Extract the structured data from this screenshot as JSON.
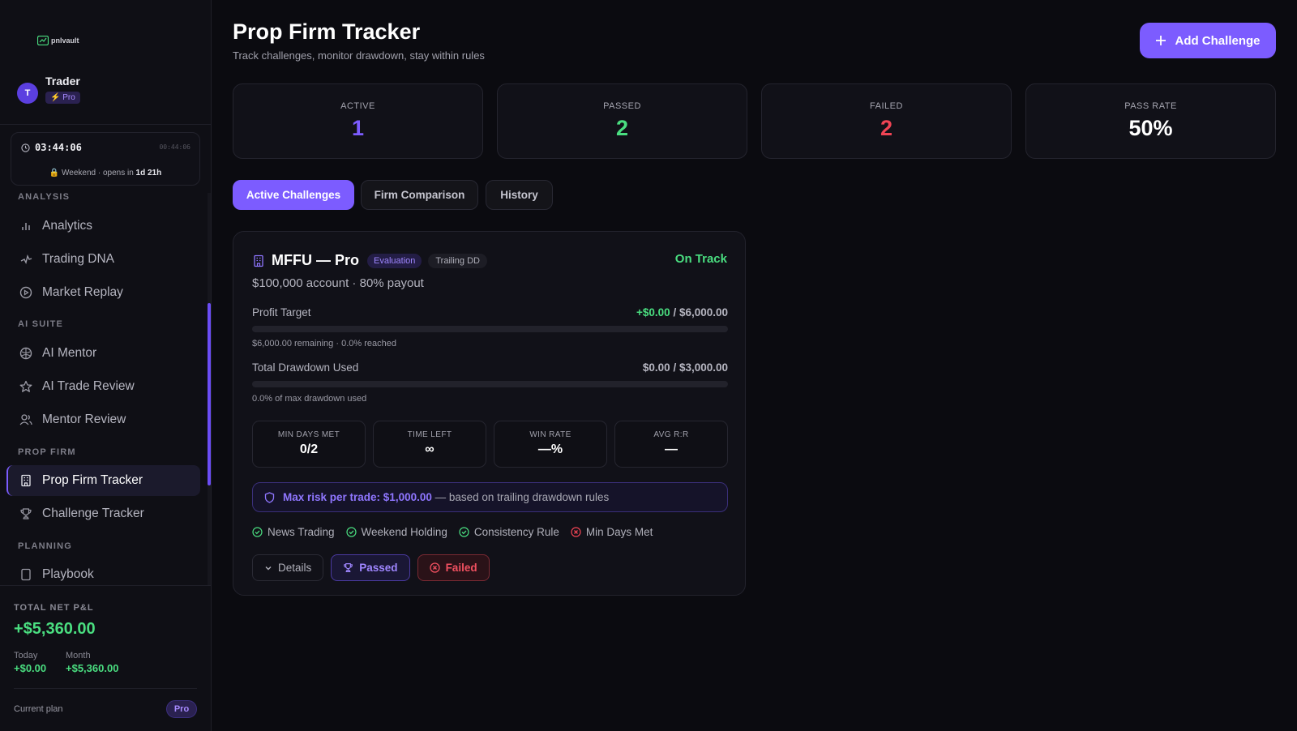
{
  "app": {
    "logo_text": "pnlvault",
    "user_name": "Trader",
    "user_initial": "T",
    "plan_chip": "⚡ Pro"
  },
  "session": {
    "time": "03:44:06",
    "time_small": "00:44:06",
    "status_prefix": "🔒 Weekend · opens in ",
    "status_time": "1d 21h"
  },
  "sidebar": {
    "sections": [
      {
        "label": "ANALYSIS",
        "items": [
          {
            "label": "Analytics",
            "icon": "bar-chart-icon"
          },
          {
            "label": "Trading DNA",
            "icon": "dna-icon"
          },
          {
            "label": "Market Replay",
            "icon": "play-circle-icon"
          }
        ]
      },
      {
        "label": "AI SUITE",
        "items": [
          {
            "label": "AI Mentor",
            "icon": "brain-icon"
          },
          {
            "label": "AI Trade Review",
            "icon": "star-icon"
          },
          {
            "label": "Mentor Review",
            "icon": "users-icon"
          }
        ]
      },
      {
        "label": "PROP FIRM",
        "items": [
          {
            "label": "Prop Firm Tracker",
            "icon": "building-icon",
            "active": true
          },
          {
            "label": "Challenge Tracker",
            "icon": "trophy-icon"
          }
        ]
      },
      {
        "label": "PLANNING",
        "items": [
          {
            "label": "Playbook",
            "icon": "book-icon"
          }
        ]
      }
    ]
  },
  "pnl": {
    "label": "TOTAL NET P&L",
    "value": "+$5,360.00",
    "today_label": "Today",
    "today_value": "+$0.00",
    "month_label": "Month",
    "month_value": "+$5,360.00",
    "plan_label": "Current plan",
    "plan_value": "Pro"
  },
  "header": {
    "title": "Prop Firm Tracker",
    "subtitle": "Track challenges, monitor drawdown, stay within rules",
    "add_button": "Add Challenge"
  },
  "stats": [
    {
      "label": "ACTIVE",
      "value": "1",
      "color": "#7c5cff"
    },
    {
      "label": "PASSED",
      "value": "2",
      "color": "#4ade80"
    },
    {
      "label": "FAILED",
      "value": "2",
      "color": "#f04454"
    },
    {
      "label": "PASS RATE",
      "value": "50%",
      "color": "#ffffff"
    }
  ],
  "tabs": [
    {
      "label": "Active Challenges",
      "active": true
    },
    {
      "label": "Firm Comparison"
    },
    {
      "label": "History"
    }
  ],
  "challenge": {
    "name": "MFFU — Pro",
    "badge_eval": "Evaluation",
    "badge_dd": "Trailing DD",
    "status": "On Track",
    "subtitle": "$100,000 account · 80% payout",
    "profit": {
      "label": "Profit Target",
      "current": "+$0.00",
      "target": " / $6,000.00",
      "note": "$6,000.00 remaining · 0.0% reached",
      "progress": 0.0
    },
    "drawdown": {
      "label": "Total Drawdown Used",
      "amount": "$0.00 / $3,000.00",
      "note": "0.0% of max drawdown used",
      "progress": 0.0
    },
    "metrics": [
      {
        "label": "MIN DAYS MET",
        "value": "0/2"
      },
      {
        "label": "TIME LEFT",
        "value": "∞"
      },
      {
        "label": "WIN RATE",
        "value": "—%"
      },
      {
        "label": "AVG R:R",
        "value": "—"
      }
    ],
    "risk": {
      "highlight": "Max risk per trade: $1,000.00",
      "rest": " — based on trailing drawdown rules"
    },
    "rules": [
      {
        "label": "News Trading",
        "ok": true
      },
      {
        "label": "Weekend Holding",
        "ok": true
      },
      {
        "label": "Consistency Rule",
        "ok": true
      },
      {
        "label": "Min Days Met",
        "ok": false
      }
    ],
    "actions": {
      "details": "Details",
      "passed": "Passed",
      "failed": "Failed"
    }
  }
}
